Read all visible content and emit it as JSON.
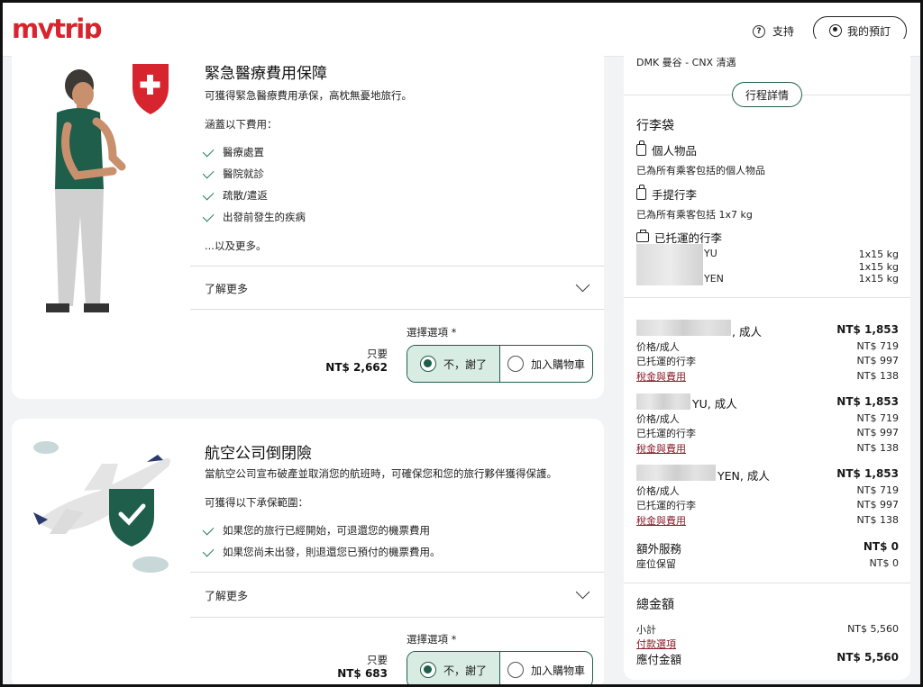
{
  "header": {
    "logo_main": "mytr",
    "logo_accent": "i",
    "logo_end": "p",
    "support_label": "支持",
    "booking_label": "我的預訂"
  },
  "card1": {
    "title": "緊急醫療費用保障",
    "subtitle": "可獲得緊急醫療費用承保，高枕無憂地旅行。",
    "cover_label": "涵蓋以下費用：",
    "items": [
      "醫療處置",
      "醫院就診",
      "疏散/遣返",
      "出發前發生的疾病"
    ],
    "more": "...以及更多。",
    "learn_more": "了解更多",
    "select_label": "選擇選項 *",
    "only": "只要",
    "price": "NT$ 2,662",
    "option_no": "不，謝了",
    "option_add": "加入購物車"
  },
  "card2": {
    "title": "航空公司倒閉險",
    "subtitle": "當航空公司宣布破產並取消您的航班時，可確保您和您的旅行夥伴獲得保護。",
    "cover_label": "可獲得以下承保範圍：",
    "items": [
      "如果您的旅行已經開始，可退還您的機票費用",
      "如果您尚未出發，則退還您已預付的機票費用。"
    ],
    "learn_more": "了解更多",
    "select_label": "選擇選項 *",
    "only": "只要",
    "price": "NT$ 683",
    "option_no": "不，謝了",
    "option_add": "加入購物車"
  },
  "sidebar": {
    "route": "DMK 曼谷 - CNX 清邁",
    "details_button": "行程詳情",
    "baggage_title": "行李袋",
    "personal_item": "個人物品",
    "personal_desc": "已為所有乘客包括的個人物品",
    "carry_on": "手提行李",
    "carry_desc": "已為所有乘客包括 1x7 kg",
    "checked": "已托運的行李",
    "checked_rows": [
      {
        "name": "YU",
        "weight": "1x15 kg"
      },
      {
        "name": "",
        "weight": "1x15 kg"
      },
      {
        "name": "YEN",
        "weight": "1x15 kg"
      }
    ],
    "passengers": [
      {
        "name": ", 成人",
        "total": "NT$ 1,853",
        "fare_label": "价格/成人",
        "fare": "NT$ 719",
        "bag_label": "已托運的行李",
        "bag": "NT$ 997",
        "tax_label": "稅金與費用",
        "tax": "NT$ 138"
      },
      {
        "name": "YU, 成人",
        "total": "NT$ 1,853",
        "fare_label": "价格/成人",
        "fare": "NT$ 719",
        "bag_label": "已托運的行李",
        "bag": "NT$ 997",
        "tax_label": "稅金與費用",
        "tax": "NT$ 138"
      },
      {
        "name": "YEN, 成人",
        "total": "NT$ 1,853",
        "fare_label": "价格/成人",
        "fare": "NT$ 719",
        "bag_label": "已托運的行李",
        "bag": "NT$ 997",
        "tax_label": "稅金與費用",
        "tax": "NT$ 138"
      }
    ],
    "extras_title": "額外服務",
    "extras_total": "NT$ 0",
    "seat_label": "座位保留",
    "seat_value": "NT$ 0",
    "total_title": "總金額",
    "subtotal_label": "小計",
    "subtotal_value": "NT$ 5,560",
    "payment_options": "付款選項",
    "due_label": "應付金額",
    "due_value": "NT$ 5,560"
  },
  "colors": {
    "brand_red": "#d6252e",
    "accent_green": "#1f5e4b",
    "shield_green": "#1f5e4b",
    "link_red": "#8a1c2a"
  }
}
